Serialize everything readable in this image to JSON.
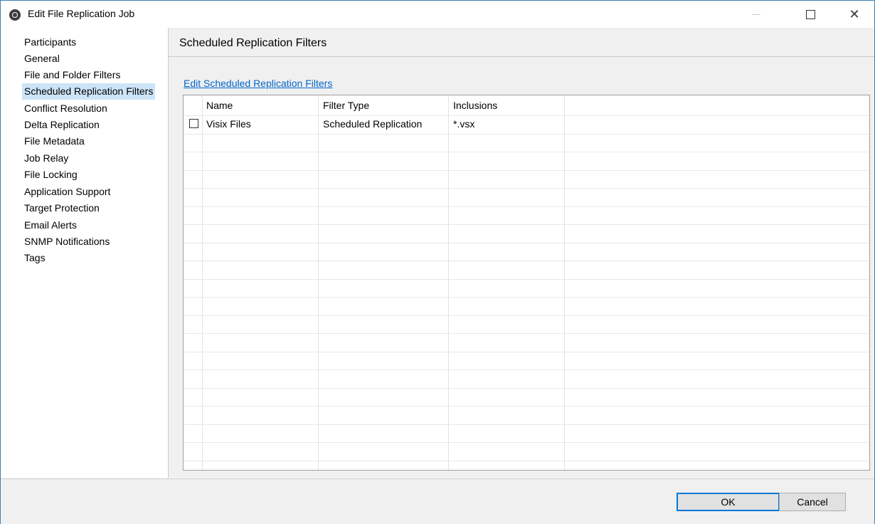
{
  "window": {
    "title": "Edit File Replication Job",
    "icon": "peer-app-icon"
  },
  "sidebar": {
    "items": [
      {
        "label": "Participants"
      },
      {
        "label": "General"
      },
      {
        "label": "File and Folder Filters"
      },
      {
        "label": "Scheduled Replication Filters",
        "selected": true
      },
      {
        "label": "Conflict Resolution"
      },
      {
        "label": "Delta Replication"
      },
      {
        "label": "File Metadata"
      },
      {
        "label": "Job Relay"
      },
      {
        "label": "File Locking"
      },
      {
        "label": "Application Support"
      },
      {
        "label": "Target Protection"
      },
      {
        "label": "Email Alerts"
      },
      {
        "label": "SNMP Notifications"
      },
      {
        "label": "Tags"
      }
    ]
  },
  "main": {
    "title": "Scheduled Replication Filters",
    "edit_link": "Edit Scheduled Replication Filters",
    "table": {
      "columns": [
        "Name",
        "Filter Type",
        "Inclusions"
      ],
      "rows": [
        {
          "checked": false,
          "name": "Visix Files",
          "filter_type": "Scheduled Replication",
          "inclusions": "*.vsx"
        }
      ]
    }
  },
  "footer": {
    "ok_label": "OK",
    "cancel_label": "Cancel"
  },
  "colors": {
    "selection": "#cce4f7",
    "link": "#0066cc",
    "accent": "#0078d7",
    "panel": "#f0f0f0"
  }
}
